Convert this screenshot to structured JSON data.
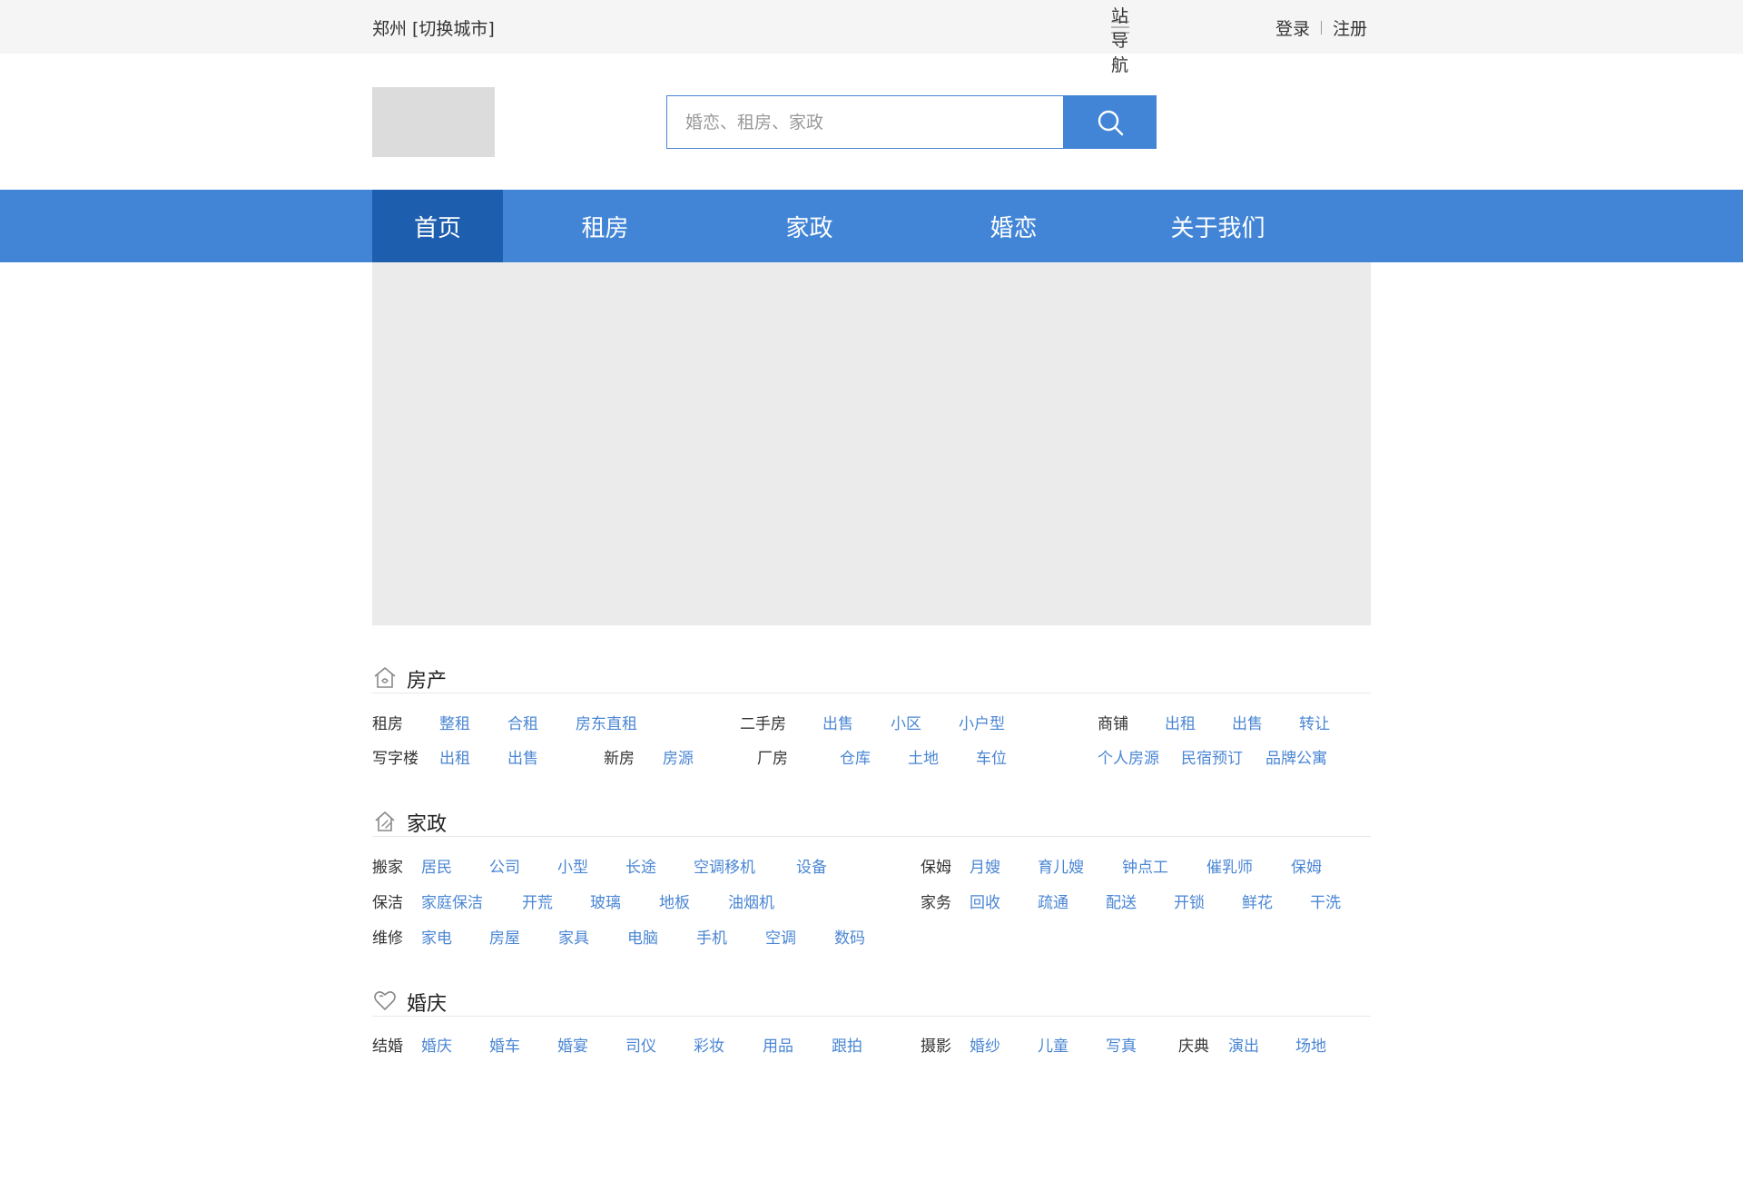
{
  "topbar": {
    "city": "郑州",
    "switch_city": "[切换城市]",
    "site_nav": "网站导航",
    "login": "登录",
    "register": "注册"
  },
  "search": {
    "placeholder": "婚恋、租房、家政"
  },
  "nav": {
    "items": [
      "首页",
      "租房",
      "家政",
      "婚恋",
      "关于我们"
    ],
    "active": "首页"
  },
  "sections": {
    "realestate": {
      "title": "房产",
      "rent": {
        "label": "租房",
        "links": [
          "整租",
          "合租",
          "房东直租"
        ]
      },
      "secondhand": {
        "label": "二手房",
        "links": [
          "出售",
          "小区",
          "小户型"
        ]
      },
      "shop": {
        "label": "商铺",
        "links": [
          "出租",
          "出售",
          "转让"
        ]
      },
      "office": {
        "label": "写字楼",
        "links": [
          "出租",
          "出售"
        ]
      },
      "newhouse": {
        "label": "新房",
        "links": [
          "房源"
        ]
      },
      "factory": {
        "label": "厂房",
        "links": [
          "仓库",
          "土地",
          "车位"
        ]
      },
      "extra": {
        "links": [
          "个人房源",
          "民宿预订",
          "品牌公寓"
        ]
      }
    },
    "housekeeping": {
      "title": "家政",
      "moving": {
        "label": "搬家",
        "links": [
          "居民",
          "公司",
          "小型",
          "长途",
          "空调移机",
          "设备"
        ]
      },
      "nanny": {
        "label": "保姆",
        "links": [
          "月嫂",
          "育儿嫂",
          "钟点工",
          "催乳师",
          "保姆"
        ]
      },
      "cleaning": {
        "label": "保洁",
        "links": [
          "家庭保洁",
          "开荒",
          "玻璃",
          "地板",
          "油烟机"
        ]
      },
      "chores": {
        "label": "家务",
        "links": [
          "回收",
          "疏通",
          "配送",
          "开锁",
          "鲜花",
          "干洗"
        ]
      },
      "repair": {
        "label": "维修",
        "links": [
          "家电",
          "房屋",
          "家具",
          "电脑",
          "手机",
          "空调",
          "数码"
        ]
      }
    },
    "wedding": {
      "title": "婚庆",
      "marriage": {
        "label": "结婚",
        "links": [
          "婚庆",
          "婚车",
          "婚宴",
          "司仪",
          "彩妆",
          "用品",
          "跟拍"
        ]
      },
      "photo": {
        "label": "摄影",
        "links": [
          "婚纱",
          "儿童",
          "写真"
        ]
      },
      "celebration": {
        "label": "庆典",
        "links": [
          "演出",
          "场地"
        ]
      }
    }
  },
  "colors": {
    "primary": "#4285d6",
    "nav_active": "#1e5eae",
    "link": "#4a86d4",
    "topbar_bg": "#f5f5f5",
    "placeholder_bg": "#ebebeb"
  }
}
